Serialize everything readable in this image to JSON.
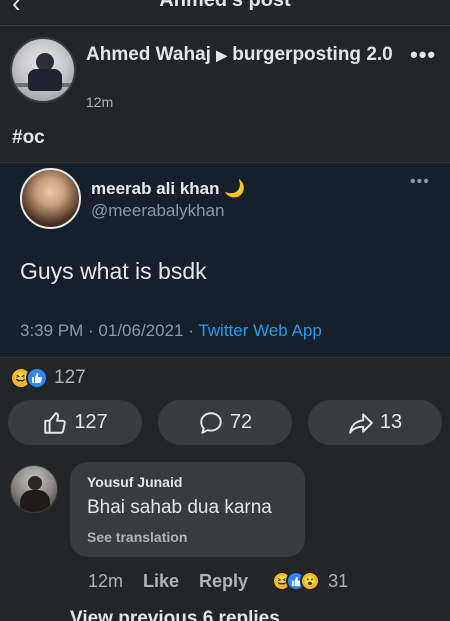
{
  "topbar": {
    "back_icon": "back-arrow-icon",
    "title": "Ahmed's post"
  },
  "post": {
    "author": "Ahmed Wahaj",
    "arrow": "▶",
    "group": "burgerposting 2.0",
    "time": "12m",
    "more_icon": "more-horizontal-icon",
    "text": "#oc"
  },
  "tweet": {
    "name": "meerab ali khan 🌙",
    "handle": "@meerabalykhan",
    "text": "Guys what is bsdk",
    "timestamp": "3:39 PM · 01/06/2021 · ",
    "app": "Twitter Web App"
  },
  "reactions": {
    "icons": [
      "haha-reaction-icon",
      "like-reaction-icon"
    ],
    "count": "127"
  },
  "actions": {
    "like_count": "127",
    "comment_count": "72",
    "share_count": "13"
  },
  "comment": {
    "author": "Yousuf Junaid",
    "text": "Bhai sahab dua karna",
    "translate_label": "See translation",
    "time": "12m",
    "like_label": "Like",
    "reply_label": "Reply",
    "reaction_icons": [
      "haha-reaction-icon",
      "like-reaction-icon",
      "wow-reaction-icon"
    ],
    "reaction_count": "31"
  },
  "view_replies_label": "View previous 6 replies",
  "colors": {
    "background": "#242526",
    "tweet_background": "#15202b",
    "twitter_blue": "#1d9bf0",
    "button_gray": "#3a3b3c"
  }
}
